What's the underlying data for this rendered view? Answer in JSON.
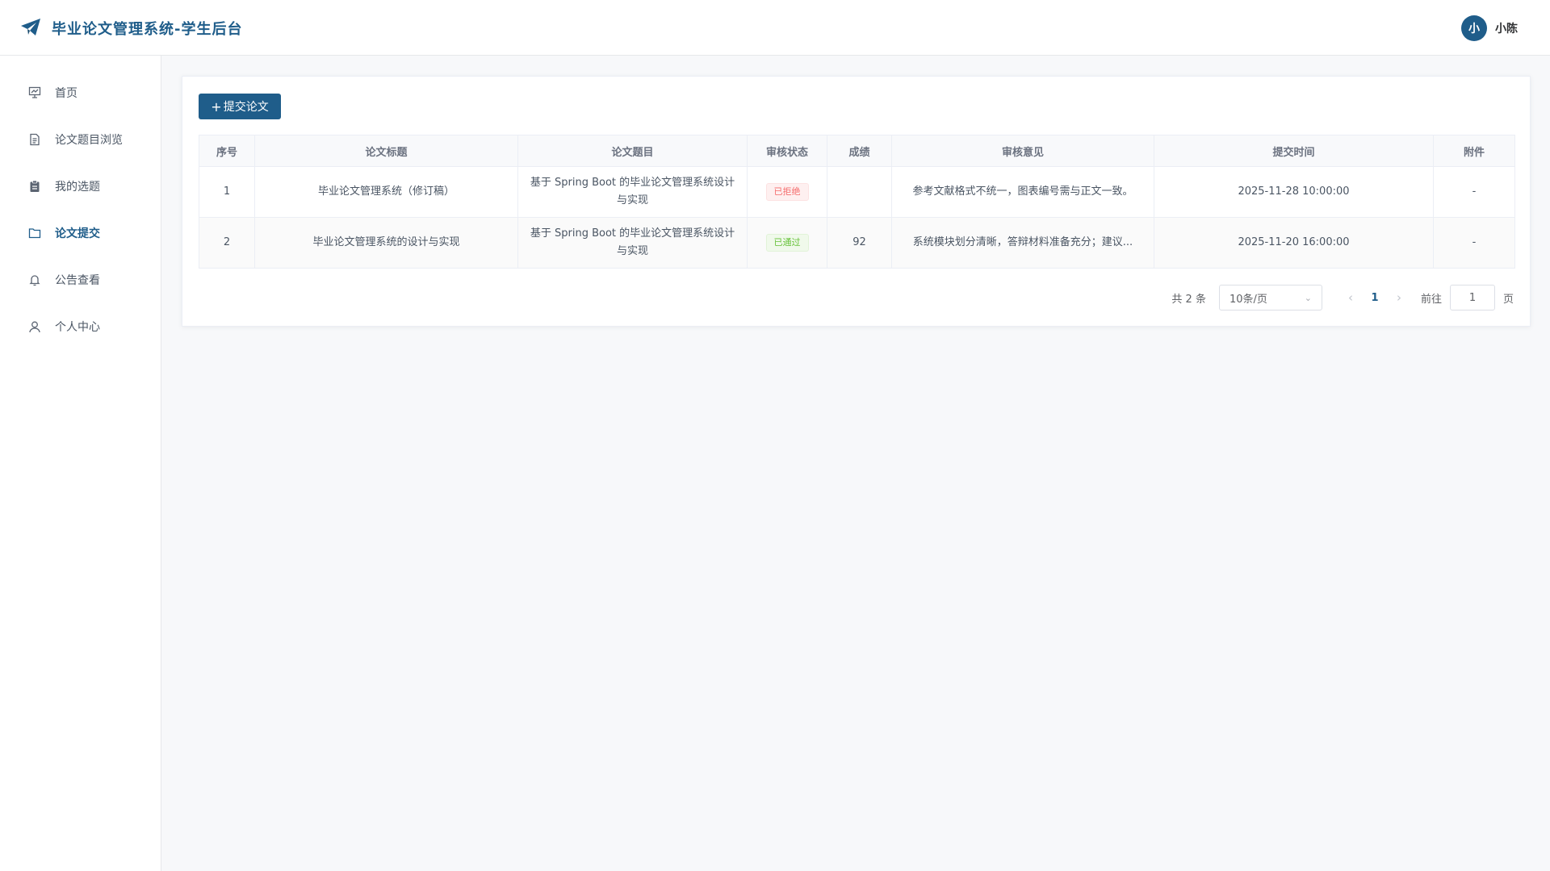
{
  "header": {
    "title": "毕业论文管理系统-学生后台",
    "logo_icon": "paper-plane-icon",
    "user": {
      "avatar_text": "小",
      "name": "小陈"
    }
  },
  "colors": {
    "primary": "#1f5d8a",
    "rejected": "#f56c6c",
    "passed": "#67c23a"
  },
  "sidebar": {
    "items": [
      {
        "label": "首页",
        "icon": "presentation-icon",
        "active": false
      },
      {
        "label": "论文题目浏览",
        "icon": "document-icon",
        "active": false
      },
      {
        "label": "我的选题",
        "icon": "clipboard-icon",
        "active": false
      },
      {
        "label": "论文提交",
        "icon": "folder-icon",
        "active": true
      },
      {
        "label": "公告查看",
        "icon": "bell-icon",
        "active": false
      },
      {
        "label": "个人中心",
        "icon": "user-icon",
        "active": false
      }
    ]
  },
  "main": {
    "submit_button": {
      "plus": "+",
      "label": "提交论文"
    },
    "table": {
      "columns": [
        "序号",
        "论文标题",
        "论文题目",
        "审核状态",
        "成绩",
        "审核意见",
        "提交时间",
        "附件"
      ],
      "rows": [
        {
          "index": "1",
          "title": "毕业论文管理系统（修订稿）",
          "topic": "基于 Spring Boot 的毕业论文管理系统设计与实现",
          "status": "已拒绝",
          "score": "",
          "comment": "参考文献格式不统一，图表编号需与正文一致。",
          "time": "2025-11-28 10:00:00",
          "attachment": "-"
        },
        {
          "index": "2",
          "title": "毕业论文管理系统的设计与实现",
          "topic": "基于 Spring Boot 的毕业论文管理系统设计与实现",
          "status": "已通过",
          "score": "92",
          "comment": "系统模块划分清晰，答辩材料准备充分；建议...",
          "time": "2025-11-20 16:00:00",
          "attachment": "-"
        }
      ]
    },
    "pagination": {
      "total": "共 2 条",
      "page_size": "10条/页",
      "current_page": "1",
      "goto_label": "前往",
      "goto_value": "1",
      "page_unit": "页"
    }
  }
}
